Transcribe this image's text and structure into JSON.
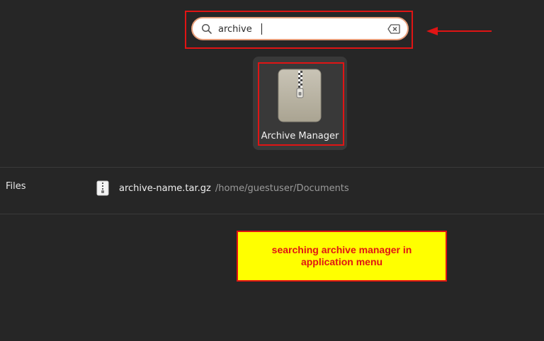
{
  "search": {
    "value": "archive",
    "icon": "search-icon",
    "clear_icon": "clear-text-icon"
  },
  "app_results": [
    {
      "name": "Archive Manager",
      "icon": "archive-zip-icon"
    }
  ],
  "file_results": {
    "section_label": "Files",
    "items": [
      {
        "name": "archive-name.tar.gz",
        "path": "/home/guestuser/Documents",
        "icon": "archive-file-icon"
      }
    ]
  },
  "annotation": {
    "note": "searching archive manager in application menu",
    "colors": {
      "highlight": "#e01414",
      "note_background": "#ffff00",
      "note_text": "#e01414"
    }
  }
}
